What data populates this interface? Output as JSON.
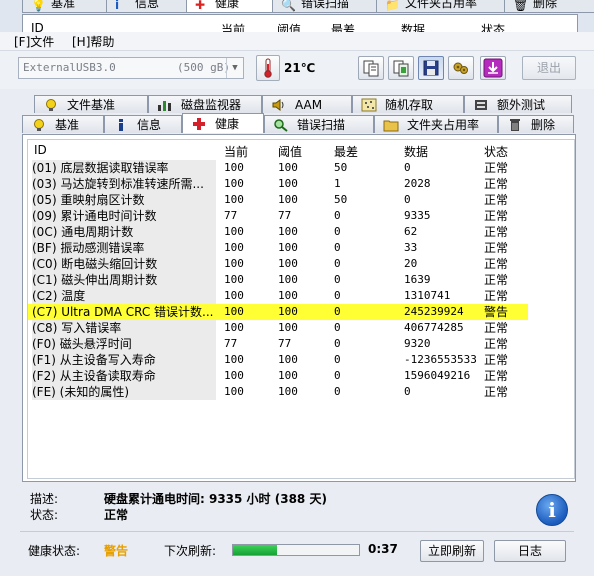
{
  "background_window": {
    "tabs": [
      {
        "label": "基准",
        "icon": "bulb-icon",
        "selected": false
      },
      {
        "label": "信息",
        "icon": "info-icon",
        "selected": false
      },
      {
        "label": "健康",
        "icon": "red-cross-icon",
        "selected": true
      },
      {
        "label": "错误扫描",
        "icon": "magnifier-icon",
        "selected": false
      },
      {
        "label": "文件夹占用率",
        "icon": "folder-icon",
        "selected": false
      },
      {
        "label": "删除",
        "icon": "trash-icon",
        "selected": false
      }
    ],
    "columns": [
      "ID",
      "当前",
      "阈值",
      "最差",
      "数据",
      "状态"
    ]
  },
  "menu": {
    "file": "[F]文件",
    "help": "[H]帮助"
  },
  "toolbar": {
    "drive_name": "ExternalUSB3.0",
    "drive_size": "(500 gB)",
    "temperature": "21℃",
    "exit_label": "退出",
    "buttons": [
      "copy-text-icon",
      "copy-screenshot-icon",
      "save-icon",
      "options-icon",
      "download-icon"
    ]
  },
  "tabs_row1": [
    {
      "label": "文件基准",
      "icon": "bulb-file-icon"
    },
    {
      "label": "磁盘监视器",
      "icon": "bar-chart-icon"
    },
    {
      "label": "AAM",
      "icon": "speaker-icon"
    },
    {
      "label": "随机存取",
      "icon": "dots-icon"
    },
    {
      "label": "额外测试",
      "icon": "extra-test-icon"
    }
  ],
  "tabs_row2": [
    {
      "label": "基准",
      "icon": "bulb-icon",
      "selected": false
    },
    {
      "label": "信息",
      "icon": "info-icon",
      "selected": false
    },
    {
      "label": "健康",
      "icon": "red-cross-icon",
      "selected": true
    },
    {
      "label": "错误扫描",
      "icon": "magnifier-icon",
      "selected": false
    },
    {
      "label": "文件夹占用率",
      "icon": "folder-icon",
      "selected": false
    },
    {
      "label": "删除",
      "icon": "trash-icon",
      "selected": false
    }
  ],
  "table": {
    "columns": [
      "ID",
      "当前",
      "阈值",
      "最差",
      "数据",
      "状态"
    ],
    "rows": [
      {
        "id": "(01) 底层数据读取错误率",
        "current": "100",
        "threshold": "100",
        "worst": "50",
        "data": "0",
        "status": "正常",
        "warn": false
      },
      {
        "id": "(03) 马达旋转到标准转速所需...",
        "current": "100",
        "threshold": "100",
        "worst": "1",
        "data": "2028",
        "status": "正常",
        "warn": false
      },
      {
        "id": "(05) 重映射扇区计数",
        "current": "100",
        "threshold": "100",
        "worst": "50",
        "data": "0",
        "status": "正常",
        "warn": false
      },
      {
        "id": "(09) 累计通电时间计数",
        "current": "77",
        "threshold": "77",
        "worst": "0",
        "data": "9335",
        "status": "正常",
        "warn": false
      },
      {
        "id": "(0C) 通电周期计数",
        "current": "100",
        "threshold": "100",
        "worst": "0",
        "data": "62",
        "status": "正常",
        "warn": false
      },
      {
        "id": "(BF) 振动感测错误率",
        "current": "100",
        "threshold": "100",
        "worst": "0",
        "data": "33",
        "status": "正常",
        "warn": false
      },
      {
        "id": "(C0) 断电磁头缩回计数",
        "current": "100",
        "threshold": "100",
        "worst": "0",
        "data": "20",
        "status": "正常",
        "warn": false
      },
      {
        "id": "(C1) 磁头伸出周期计数",
        "current": "100",
        "threshold": "100",
        "worst": "0",
        "data": "1639",
        "status": "正常",
        "warn": false
      },
      {
        "id": "(C2) 温度",
        "current": "100",
        "threshold": "100",
        "worst": "0",
        "data": "1310741",
        "status": "正常",
        "warn": false
      },
      {
        "id": "(C7) Ultra DMA CRC 错误计数...",
        "current": "100",
        "threshold": "100",
        "worst": "0",
        "data": "245239924",
        "status": "警告",
        "warn": true
      },
      {
        "id": "(C8) 写入错误率",
        "current": "100",
        "threshold": "100",
        "worst": "0",
        "data": "406774285",
        "status": "正常",
        "warn": false
      },
      {
        "id": "(F0) 磁头悬浮时间",
        "current": "77",
        "threshold": "77",
        "worst": "0",
        "data": "9320",
        "status": "正常",
        "warn": false
      },
      {
        "id": "(F1) 从主设备写入寿命",
        "current": "100",
        "threshold": "100",
        "worst": "0",
        "data": "-1236553533",
        "status": "正常",
        "warn": false
      },
      {
        "id": "(F2) 从主设备读取寿命",
        "current": "100",
        "threshold": "100",
        "worst": "0",
        "data": "1596049216",
        "status": "正常",
        "warn": false
      },
      {
        "id": "(FE) (未知的属性)",
        "current": "100",
        "threshold": "100",
        "worst": "0",
        "data": "0",
        "status": "正常",
        "warn": false
      }
    ]
  },
  "description": {
    "desc_label": "描述:",
    "desc_value": "硬盘累计通电时间: 9335 小时 (388 天)",
    "status_label": "状态:",
    "status_value": "正常"
  },
  "statusbar": {
    "health_label": "健康状态:",
    "health_value": "警告",
    "next_refresh_label": "下次刷新:",
    "progress": 0.35,
    "countdown": "0:37",
    "refresh_button": "立即刷新",
    "log_button": "日志"
  },
  "colors": {
    "warn_row": "#ffff33",
    "warn_text": "#e8a000",
    "progress_fill": "#22b33e"
  }
}
